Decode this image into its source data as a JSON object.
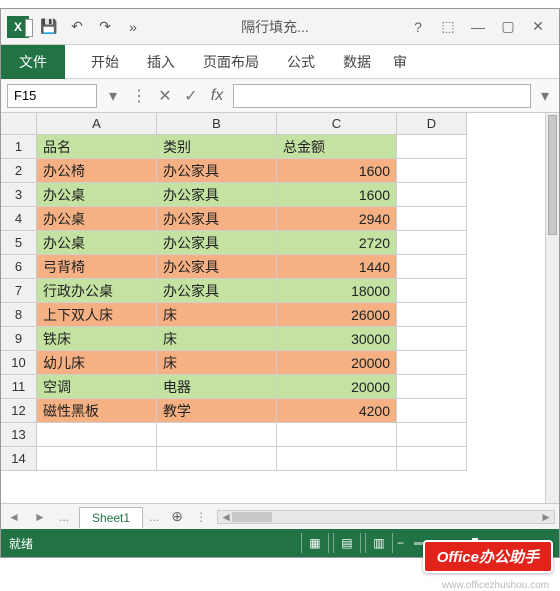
{
  "title": "隔行填充...",
  "qat": {
    "save": "💾",
    "undo": "↶",
    "redo": "↷",
    "more": "»"
  },
  "winControls": {
    "help": "?",
    "ribbonOpts": "⬚",
    "min": "—",
    "max": "▢",
    "close": "✕"
  },
  "tabs": {
    "file": "文件",
    "home": "开始",
    "insert": "插入",
    "pageLayout": "页面布局",
    "formulas": "公式",
    "data": "数据",
    "more": "审"
  },
  "nameBox": "F15",
  "fbar": {
    "cancel": "✕",
    "enter": "✓",
    "fx": "fx"
  },
  "columns": [
    "A",
    "B",
    "C",
    "D"
  ],
  "headerRow": [
    "品名",
    "类别",
    "总金额",
    ""
  ],
  "rows": [
    {
      "n": 1,
      "c": [
        "品名",
        "类别",
        "总金额",
        ""
      ],
      "cls": "green",
      "num": false
    },
    {
      "n": 2,
      "c": [
        "办公椅",
        "办公家具",
        "1600",
        ""
      ],
      "cls": "orange",
      "num": true
    },
    {
      "n": 3,
      "c": [
        "办公桌",
        "办公家具",
        "1600",
        ""
      ],
      "cls": "green",
      "num": true
    },
    {
      "n": 4,
      "c": [
        "办公桌",
        "办公家具",
        "2940",
        ""
      ],
      "cls": "orange",
      "num": true
    },
    {
      "n": 5,
      "c": [
        "办公桌",
        "办公家具",
        "2720",
        ""
      ],
      "cls": "green",
      "num": true
    },
    {
      "n": 6,
      "c": [
        "弓背椅",
        "办公家具",
        "1440",
        ""
      ],
      "cls": "orange",
      "num": true
    },
    {
      "n": 7,
      "c": [
        "行政办公桌",
        "办公家具",
        "18000",
        ""
      ],
      "cls": "green",
      "num": true
    },
    {
      "n": 8,
      "c": [
        "上下双人床",
        "床",
        "26000",
        ""
      ],
      "cls": "orange",
      "num": true
    },
    {
      "n": 9,
      "c": [
        "铁床",
        "床",
        "30000",
        ""
      ],
      "cls": "green",
      "num": true
    },
    {
      "n": 10,
      "c": [
        "幼儿床",
        "床",
        "20000",
        ""
      ],
      "cls": "orange",
      "num": true
    },
    {
      "n": 11,
      "c": [
        "空调",
        "电器",
        "20000",
        ""
      ],
      "cls": "green",
      "num": true
    },
    {
      "n": 12,
      "c": [
        "磁性黑板",
        "教学",
        "4200",
        ""
      ],
      "cls": "orange",
      "num": true
    },
    {
      "n": 13,
      "c": [
        "",
        "",
        "",
        ""
      ],
      "cls": "",
      "num": false
    },
    {
      "n": 14,
      "c": [
        "",
        "",
        "",
        ""
      ],
      "cls": "",
      "num": false
    }
  ],
  "sheetTab": "Sheet1",
  "sheetNav": {
    "prev": "◄",
    "next": "►",
    "dots": "...",
    "add": "⊕"
  },
  "status": {
    "ready": "就绪",
    "views": [
      "▦",
      "▤",
      "▥"
    ],
    "zoomMinus": "−",
    "zoomPlus": "+"
  },
  "badge": "Office办公助手",
  "watermark": "www.officezhushou.com"
}
